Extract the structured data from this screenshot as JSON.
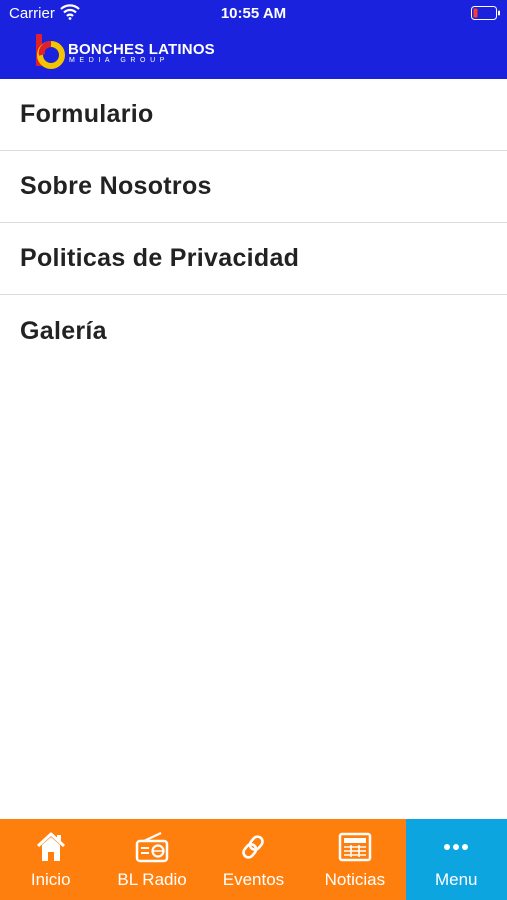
{
  "status_bar": {
    "carrier": "Carrier",
    "time": "10:55 AM"
  },
  "header": {
    "logo_line1": "BONCHES LATINOS",
    "logo_line2": "MEDIA GROUP"
  },
  "menu": {
    "items": [
      {
        "label": "Formulario"
      },
      {
        "label": "Sobre Nosotros"
      },
      {
        "label": "Politicas de Privacidad"
      },
      {
        "label": "Galería"
      }
    ]
  },
  "tabbar": {
    "items": [
      {
        "label": "Inicio",
        "icon": "home-icon"
      },
      {
        "label": "BL Radio",
        "icon": "radio-icon"
      },
      {
        "label": "Eventos",
        "icon": "link-icon"
      },
      {
        "label": "Noticias",
        "icon": "newspaper-icon"
      },
      {
        "label": "Menu",
        "icon": "more-icon",
        "active": true
      }
    ]
  },
  "colors": {
    "header": "#1a22dd",
    "tabbar": "#ff7f0e",
    "active_tab": "#0da5e0",
    "text": "#222222"
  }
}
